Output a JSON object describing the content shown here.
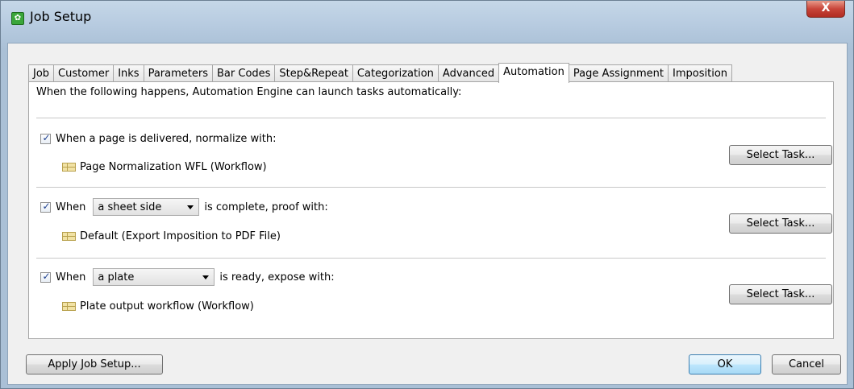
{
  "window": {
    "title": "Job Setup",
    "close_label": "X"
  },
  "tabs": [
    {
      "label": "Job"
    },
    {
      "label": "Customer"
    },
    {
      "label": "Inks"
    },
    {
      "label": "Parameters"
    },
    {
      "label": "Bar Codes"
    },
    {
      "label": "Step&Repeat"
    },
    {
      "label": "Categorization"
    },
    {
      "label": "Advanced"
    },
    {
      "label": "Automation",
      "active": true
    },
    {
      "label": "Page Assignment"
    },
    {
      "label": "Imposition"
    }
  ],
  "automation": {
    "intro": "When the following happens, Automation Engine can launch tasks automatically:",
    "rules": [
      {
        "checked": true,
        "label": "When a page is delivered, normalize with:",
        "task": "Page Normalization WFL (Workflow)",
        "button": "Select Task..."
      },
      {
        "checked": true,
        "label_pre": "When",
        "select_value": "a sheet side",
        "label_post": "is complete, proof with:",
        "task": "Default (Export Imposition to PDF File)",
        "button": "Select Task..."
      },
      {
        "checked": true,
        "label_pre": "When",
        "select_value": "a plate",
        "label_post": "is ready, expose with:",
        "task": "Plate output workflow (Workflow)",
        "button": "Select Task..."
      }
    ]
  },
  "footer": {
    "apply_label": "Apply Job Setup...",
    "ok_label": "OK",
    "cancel_label": "Cancel"
  },
  "colors": {
    "checkmark": "#1d3f8f",
    "close_button": "#c8453a",
    "task_icon": "#f1e2a5"
  }
}
